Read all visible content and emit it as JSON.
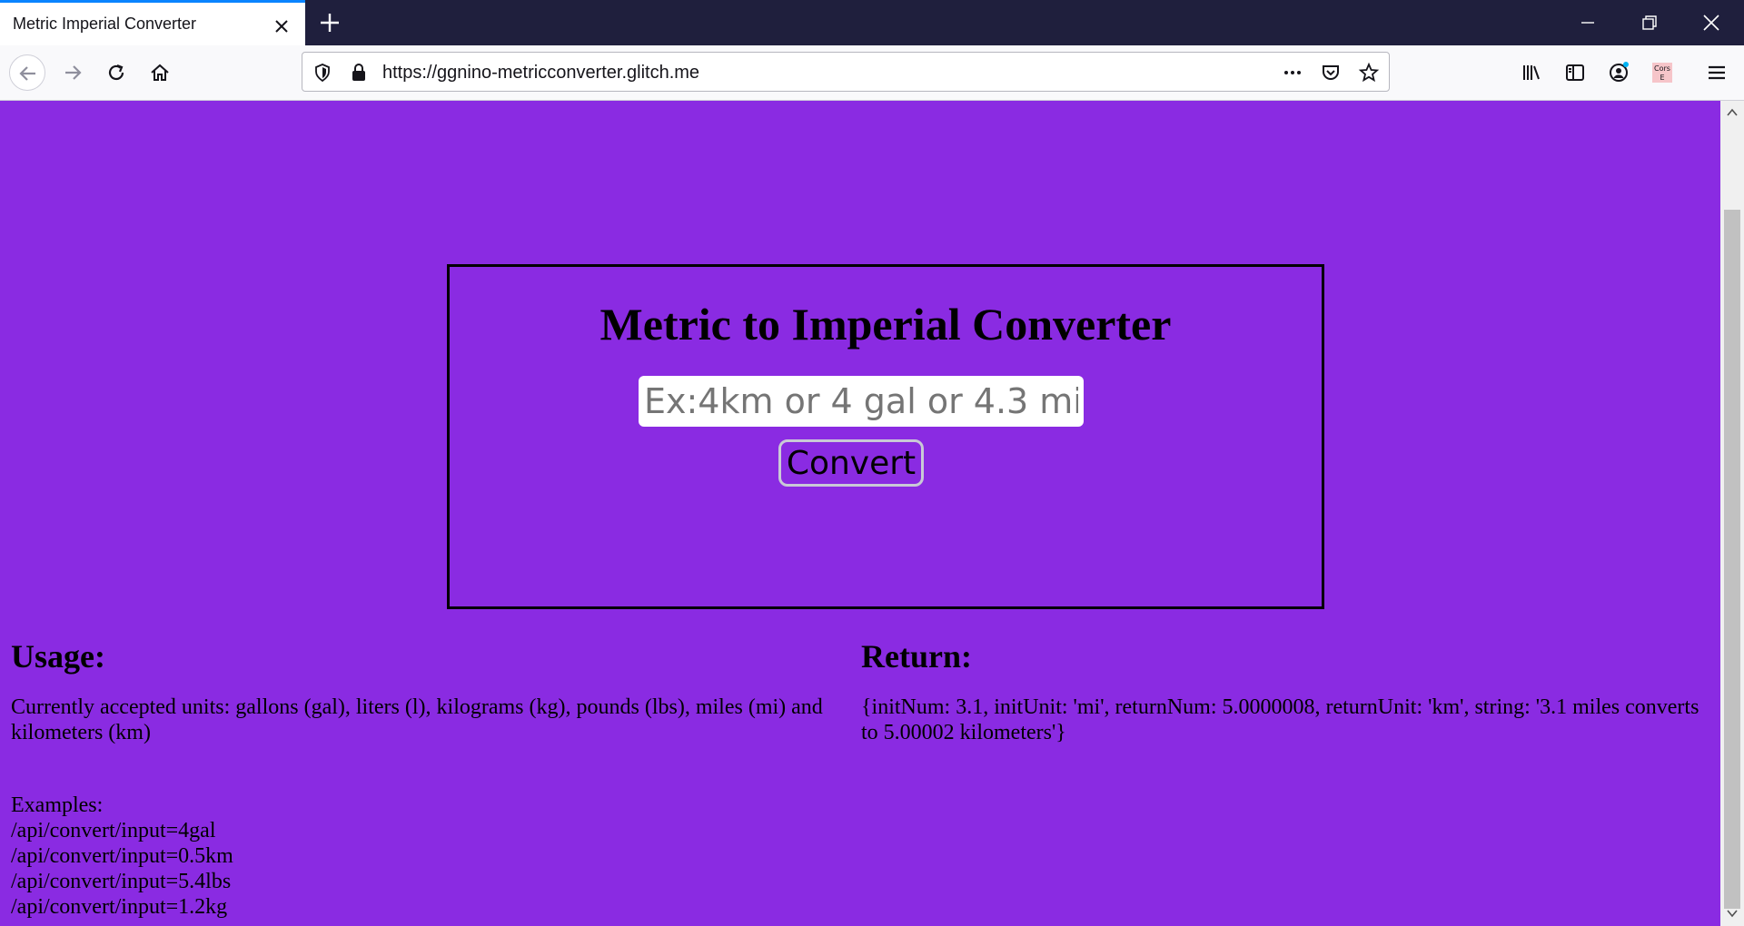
{
  "browser": {
    "tab_title": "Metric Imperial Converter",
    "url": "https://ggnino-metricconverter.glitch.me",
    "extension_label_line1": "Cors",
    "extension_label_line2": "E",
    "colors": {
      "titlebar": "#1f1f3d",
      "tab_accent": "#0a84ff",
      "toolbar": "#f9f9fb"
    },
    "icons": [
      "close-icon",
      "plus-icon",
      "minimize-icon",
      "restore-icon",
      "back-arrow-icon",
      "forward-arrow-icon",
      "reload-icon",
      "home-icon",
      "shield-icon",
      "lock-icon",
      "more-icon",
      "pocket-icon",
      "star-icon",
      "library-icon",
      "sidebar-icon",
      "account-icon",
      "menu-icon"
    ]
  },
  "page": {
    "background": "#8a2be2",
    "title": "Metric to Imperial Converter",
    "input_placeholder": "Ex:4km or 4 gal or 4.3 mi",
    "input_value": "",
    "convert_label": "Convert",
    "usage": {
      "heading": "Usage:",
      "text": "Currently accepted units: gallons (gal), liters (l), kilograms (kg), pounds (lbs), miles (mi) and kilometers (km)",
      "examples_label": "Examples:",
      "examples": [
        "/api/convert/input=4gal",
        "/api/convert/input=0.5km",
        "/api/convert/input=5.4lbs",
        "/api/convert/input=1.2kg"
      ]
    },
    "return": {
      "heading": "Return:",
      "text": "{initNum: 3.1, initUnit: 'mi', returnNum: 5.0000008, returnUnit: 'km', string: '3.1 miles converts to 5.00002 kilometers'}"
    }
  }
}
